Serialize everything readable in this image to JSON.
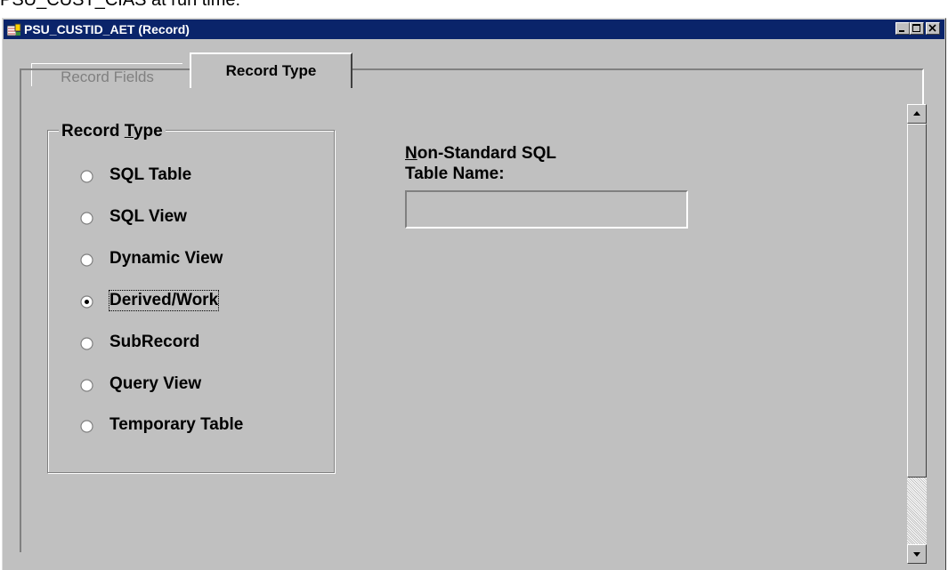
{
  "caption": "PSU_CUST_CIAS at run time:",
  "window": {
    "title": "PSU_CUSTID_AET (Record)",
    "icon": "record-app-icon",
    "buttons": {
      "minimize": "minimize-icon",
      "maximize": "maximize-icon",
      "close": "close-icon"
    }
  },
  "tabs": [
    {
      "label": "Record Fields",
      "active": false
    },
    {
      "label": "Record Type",
      "active": true
    }
  ],
  "record_type": {
    "group_title_prefix": "Record ",
    "group_title_mnemonic": "T",
    "group_title_suffix": "ype",
    "options": [
      {
        "label": "SQL Table",
        "selected": false
      },
      {
        "label": "SQL View",
        "selected": false
      },
      {
        "label": "Dynamic View",
        "selected": false
      },
      {
        "label": "Derived/Work",
        "selected": true
      },
      {
        "label": "SubRecord",
        "selected": false
      },
      {
        "label": "Query View",
        "selected": false
      },
      {
        "label": "Temporary Table",
        "selected": false
      }
    ]
  },
  "non_standard": {
    "label_mnemonic": "N",
    "label_line1_rest": "on-Standard SQL",
    "label_line2": "Table Name:",
    "value": ""
  },
  "colors": {
    "face": "#c0c0c0",
    "titlebar": "#0a246a"
  }
}
